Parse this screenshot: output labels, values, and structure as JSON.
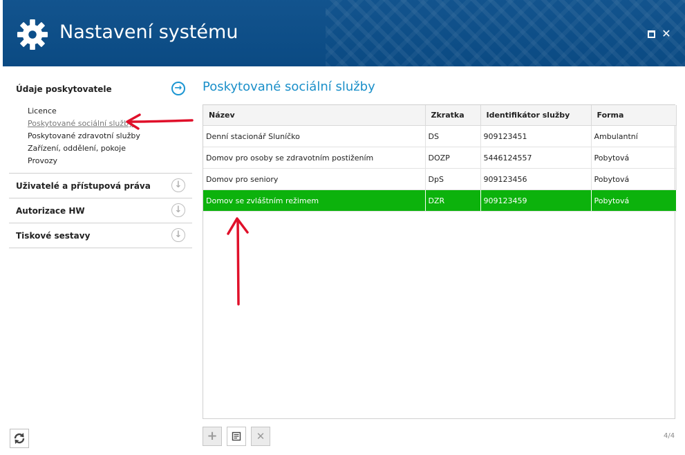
{
  "window": {
    "title": "Nastavení systému"
  },
  "sidebar": {
    "sections": [
      {
        "label": "Údaje poskytovatele",
        "expanded": true,
        "items": [
          "Licence",
          "Poskytované sociální služby",
          "Poskytované zdravotní služby",
          "Zařízení, oddělení, pokoje",
          "Provozy"
        ],
        "selected_item": "Poskytované sociální služby"
      },
      {
        "label": "Uživatelé a přístupová práva",
        "expanded": false
      },
      {
        "label": "Autorizace HW",
        "expanded": false
      },
      {
        "label": "Tiskové sestavy",
        "expanded": false
      }
    ]
  },
  "main": {
    "title": "Poskytované sociální služby",
    "table": {
      "columns": [
        "Název",
        "Zkratka",
        "Identifikátor služby",
        "Forma"
      ],
      "rows": [
        [
          "Denní stacionář Sluníčko",
          "DS",
          "909123451",
          "Ambulantní"
        ],
        [
          "Domov pro osoby se zdravotním postižením",
          "DOZP",
          "5446124557",
          "Pobytová"
        ],
        [
          "Domov pro seniory",
          "DpS",
          "909123456",
          "Pobytová"
        ],
        [
          "Domov se zvláštním režimem",
          "DZR",
          "909123459",
          "Pobytová"
        ]
      ],
      "selected_row": 3
    },
    "toolbar": {
      "add_icon": "plus-icon",
      "edit_icon": "edit-icon",
      "delete_icon": "delete-icon"
    },
    "page_count": "4/4"
  },
  "colors": {
    "titlebar": "#0b4e8a",
    "accent": "#1a8fc9",
    "selected_row": "#0cb20c",
    "annotation_arrow": "#e0102a"
  }
}
